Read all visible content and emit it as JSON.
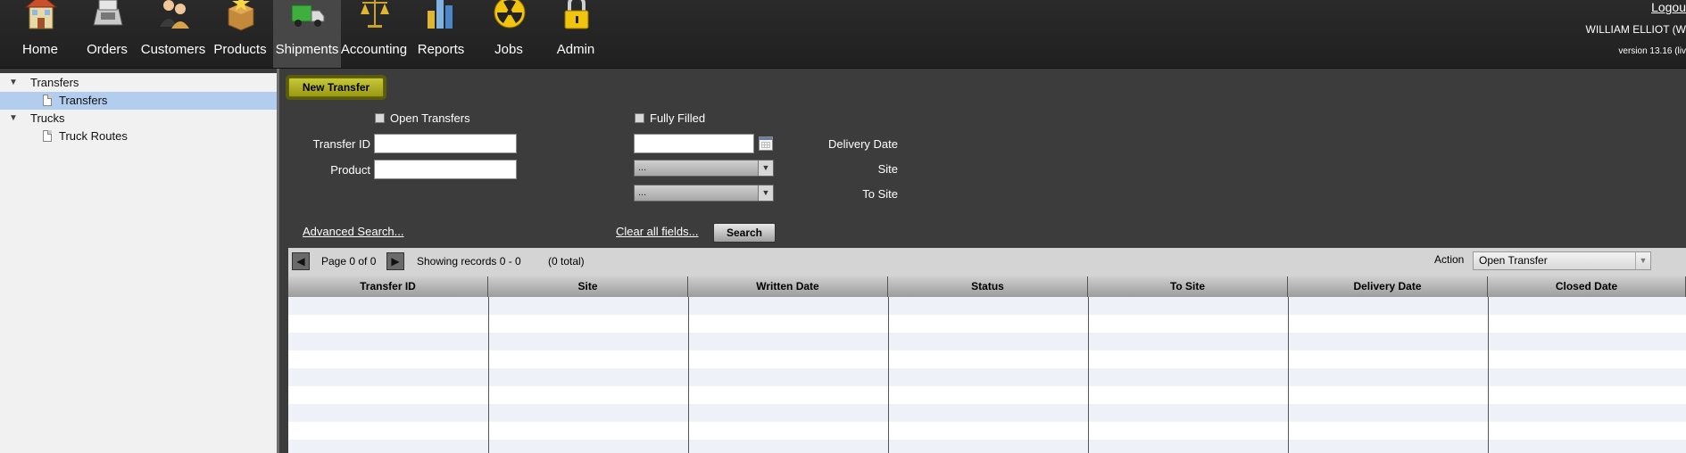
{
  "nav": {
    "items": [
      {
        "label": "Home",
        "icon": "house-icon"
      },
      {
        "label": "Orders",
        "icon": "cash-register-icon"
      },
      {
        "label": "Customers",
        "icon": "people-icon"
      },
      {
        "label": "Products",
        "icon": "boxes-icon"
      },
      {
        "label": "Shipments",
        "icon": "truck-icon"
      },
      {
        "label": "Accounting",
        "icon": "scales-icon"
      },
      {
        "label": "Reports",
        "icon": "bar-chart-icon"
      },
      {
        "label": "Jobs",
        "icon": "radiation-icon"
      },
      {
        "label": "Admin",
        "icon": "padlock-icon"
      }
    ],
    "active": "Shipments",
    "logout": "Logou",
    "user": "WILLIAM ELLIOT (W",
    "version": "version 13.16 (liv"
  },
  "tree": {
    "groups": [
      {
        "label": "Transfers",
        "children": [
          "Transfers"
        ]
      },
      {
        "label": "Trucks",
        "children": [
          "Truck Routes"
        ]
      }
    ],
    "selected": "Transfers"
  },
  "search": {
    "new_button": "New Transfer",
    "open_transfers": "Open Transfers",
    "fully_filled": "Fully Filled",
    "transfer_id_label": "Transfer ID",
    "transfer_id_value": "",
    "product_label": "Product",
    "product_value": "",
    "delivery_date_label": "Delivery Date",
    "delivery_date_value": "",
    "site_label": "Site",
    "site_value": "...",
    "to_site_label": "To Site",
    "to_site_value": "...",
    "advanced_link": "Advanced Search...",
    "clear_link": "Clear all fields...",
    "search_button": "Search"
  },
  "grid_toolbar": {
    "page_text": "Page 0 of 0",
    "records_text": "Showing records 0 - 0",
    "total_text": "(0 total)",
    "action_label": "Action",
    "action_value": "Open Transfer"
  },
  "grid": {
    "columns": [
      "Transfer ID",
      "Site",
      "Written Date",
      "Status",
      "To Site",
      "Delivery Date",
      "Closed Date"
    ]
  },
  "colors": {
    "topbar": "#232323",
    "new_button": "#b3b32a",
    "selected_tree": "#b3cdee",
    "row_alt": "#eef2f8"
  }
}
